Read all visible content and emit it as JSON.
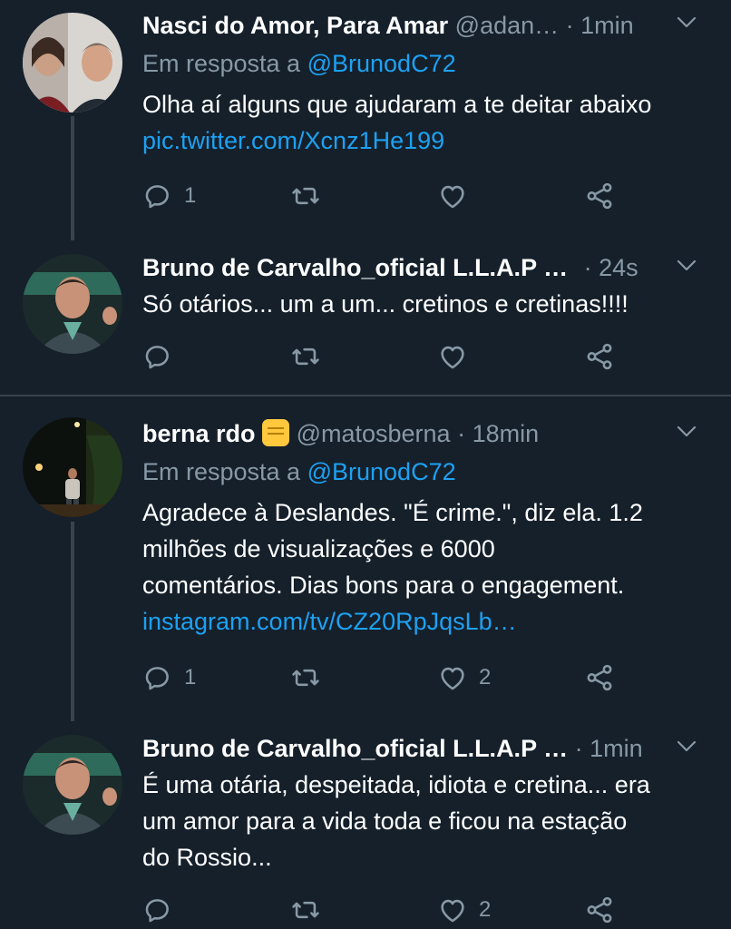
{
  "tweets": [
    {
      "name": "Nasci do Amor, Para Amar",
      "handle": "@adan…",
      "time": "· 1min",
      "reply_prefix": "Em resposta a",
      "reply_to": "@BrunodC72",
      "text": "Olha aí alguns que ajudaram a te deitar abaixo",
      "link": "pic.twitter.com/Xcnz1He199",
      "replies": "1",
      "retweets": "",
      "likes": ""
    },
    {
      "name": "Bruno de Carvalho_oficial L.L.A.P …",
      "time": "· 24s",
      "text": "Só otários... um a um... cretinos e cretinas!!!!",
      "replies": "",
      "retweets": "",
      "likes": ""
    },
    {
      "name": "berna rdo",
      "emoji": "raised-fist-emoji",
      "handle": "@matosberna",
      "time": "· 18min",
      "reply_prefix": "Em resposta a",
      "reply_to": "@BrunodC72",
      "text_lines": [
        "Agradece à Deslandes. \"É crime.\", diz ela. 1.2",
        "milhões de visualizações e 6000",
        "comentários. Dias bons para o engagement."
      ],
      "link": "instagram.com/tv/CZ20RpJqsLb…",
      "replies": "1",
      "retweets": "",
      "likes": "2"
    },
    {
      "name": "Bruno de Carvalho_oficial L.L.A.P …",
      "time": "· 1min",
      "text_lines": [
        "É uma otária, despeitada, idiota e cretina... era",
        "um amor para a vida toda e ficou na estação",
        "do Rossio..."
      ],
      "replies": "",
      "retweets": "",
      "likes": "2"
    }
  ],
  "icons": {
    "reply": "reply-icon",
    "retweet": "retweet-icon",
    "like": "heart-icon",
    "share": "share-icon",
    "menu": "chevron-down-icon"
  },
  "colors": {
    "background": "#15202b",
    "muted": "#8899a6",
    "link": "#1da1f2",
    "divider": "#38444d"
  }
}
